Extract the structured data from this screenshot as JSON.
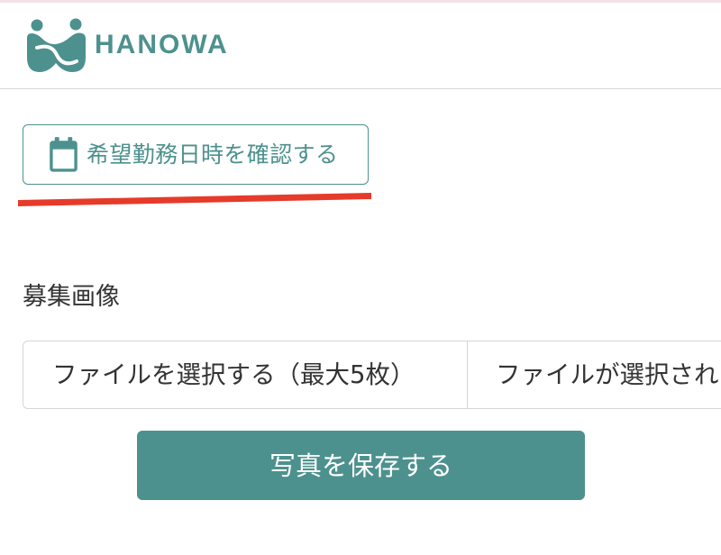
{
  "header": {
    "logo_text": "HANOWA",
    "logo_icon": "hanowa-logo-icon"
  },
  "schedule_button": {
    "icon": "calendar-icon",
    "label": "希望勤務日時を確認する"
  },
  "recruitment_images": {
    "label": "募集画像",
    "file_picker": {
      "button_label": "ファイルを選択する（最大5枚）",
      "status_text": "ファイルが選択され"
    },
    "save_button_label": "写真を保存する"
  },
  "colors": {
    "brand": "#4d918e",
    "annotation": "#e63b2a",
    "text": "#333333",
    "border": "#d6d6d6"
  }
}
